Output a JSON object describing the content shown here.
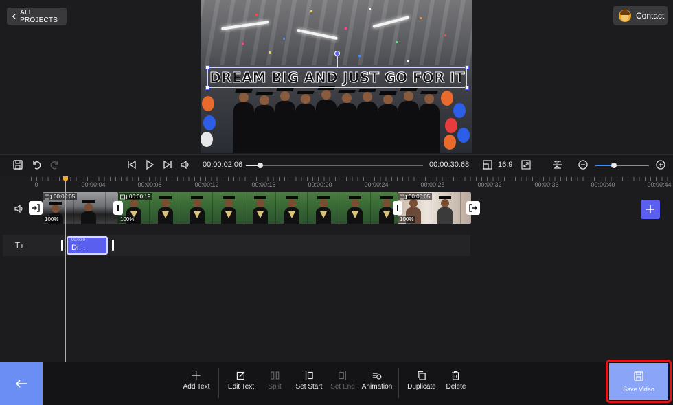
{
  "header": {
    "back_label": "ALL PROJECTS",
    "contact_label": "Contact"
  },
  "preview": {
    "text_overlay": "DREAM BIG AND JUST GO FOR IT"
  },
  "controls": {
    "current_time": "00:00:02.06",
    "total_time": "00:00:30.68",
    "aspect_ratio": "16:9",
    "scrub_progress": 0.08,
    "zoom_level": 0.35
  },
  "ruler": {
    "labels": [
      "0",
      "00:00:04",
      "00:00:08",
      "00:00:12",
      "00:00:16",
      "00:00:20",
      "00:00:24",
      "00:00:28",
      "00:00:32",
      "00:00:36",
      "00:00:40",
      "00:00:44"
    ]
  },
  "video_track": {
    "clips": [
      {
        "duration": "00:00:05",
        "volume": "100%"
      },
      {
        "duration": "00:00:19",
        "volume": "100%"
      },
      {
        "duration": "00:00:05",
        "volume": "100%"
      }
    ]
  },
  "text_track": {
    "icon_label": "Tт",
    "clip": {
      "time": "00:00:0",
      "label": "Dr..."
    }
  },
  "toolbar": {
    "add_text": "Add Text",
    "edit_text": "Edit Text",
    "split": "Split",
    "set_start": "Set Start",
    "set_end": "Set End",
    "animation": "Animation",
    "duplicate": "Duplicate",
    "delete": "Delete",
    "save_video": "Save Video"
  },
  "colors": {
    "accent": "#5b5ff0",
    "save": "#8aa5f7",
    "highlight": "#e0161b",
    "playhead": "#f0a830"
  }
}
